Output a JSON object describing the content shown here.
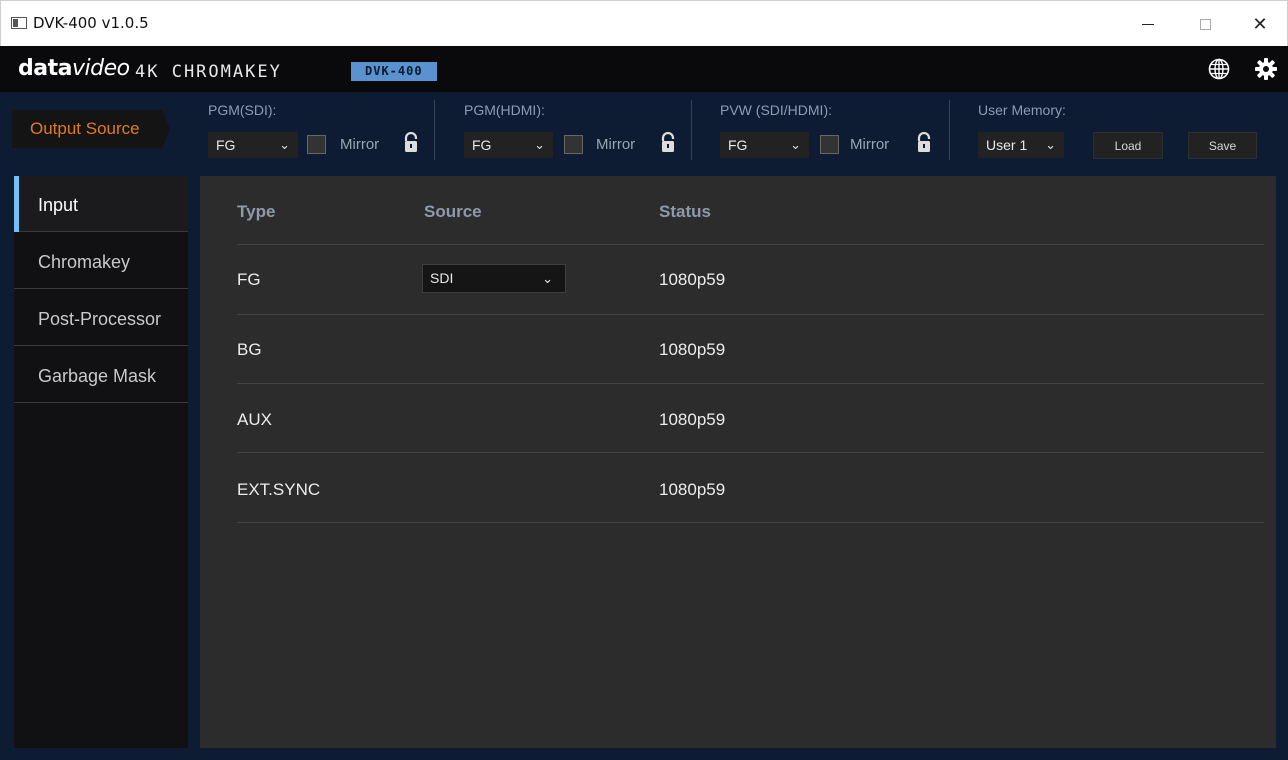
{
  "window": {
    "title": "DVK-400 v1.0.5",
    "close_glyph": "✕"
  },
  "brand": {
    "logo_bold": "data",
    "logo_thin": "video",
    "product": "4K CHROMAKEY",
    "model_badge": "DVK-400",
    "icons": [
      "globe-icon",
      "gear-icon"
    ]
  },
  "output_source": {
    "label": "Output Source",
    "pgm_sdi": {
      "label": "PGM(SDI):",
      "value": "FG",
      "mirror_label": "Mirror",
      "mirror_checked": false
    },
    "pgm_hdmi": {
      "label": "PGM(HDMI):",
      "value": "FG",
      "mirror_label": "Mirror",
      "mirror_checked": false
    },
    "pvw": {
      "label": "PVW (SDI/HDMI):",
      "value": "FG",
      "mirror_label": "Mirror",
      "mirror_checked": false
    },
    "user_memory": {
      "label": "User Memory:",
      "value": "User 1",
      "load_label": "Load",
      "save_label": "Save"
    }
  },
  "sidebar": {
    "items": [
      {
        "label": "Input",
        "active": true
      },
      {
        "label": "Chromakey",
        "active": false
      },
      {
        "label": "Post-Processor",
        "active": false
      },
      {
        "label": "Garbage Mask",
        "active": false
      }
    ]
  },
  "input_table": {
    "headers": [
      "Type",
      "Source",
      "Status"
    ],
    "rows": [
      {
        "type": "FG",
        "source": "SDI",
        "status": "1080p59"
      },
      {
        "type": "BG",
        "source": "",
        "status": "1080p59"
      },
      {
        "type": "AUX",
        "source": "",
        "status": "1080p59"
      },
      {
        "type": "EXT.SYNC",
        "source": "",
        "status": "1080p59"
      }
    ]
  },
  "colors": {
    "accent_orange": "#e07a1e",
    "active_tab_marker": "#74c2f3",
    "badge_blue": "#5a92cf",
    "panel_bg": "#2c2c2c",
    "frame_bg": "#0d1c33"
  }
}
